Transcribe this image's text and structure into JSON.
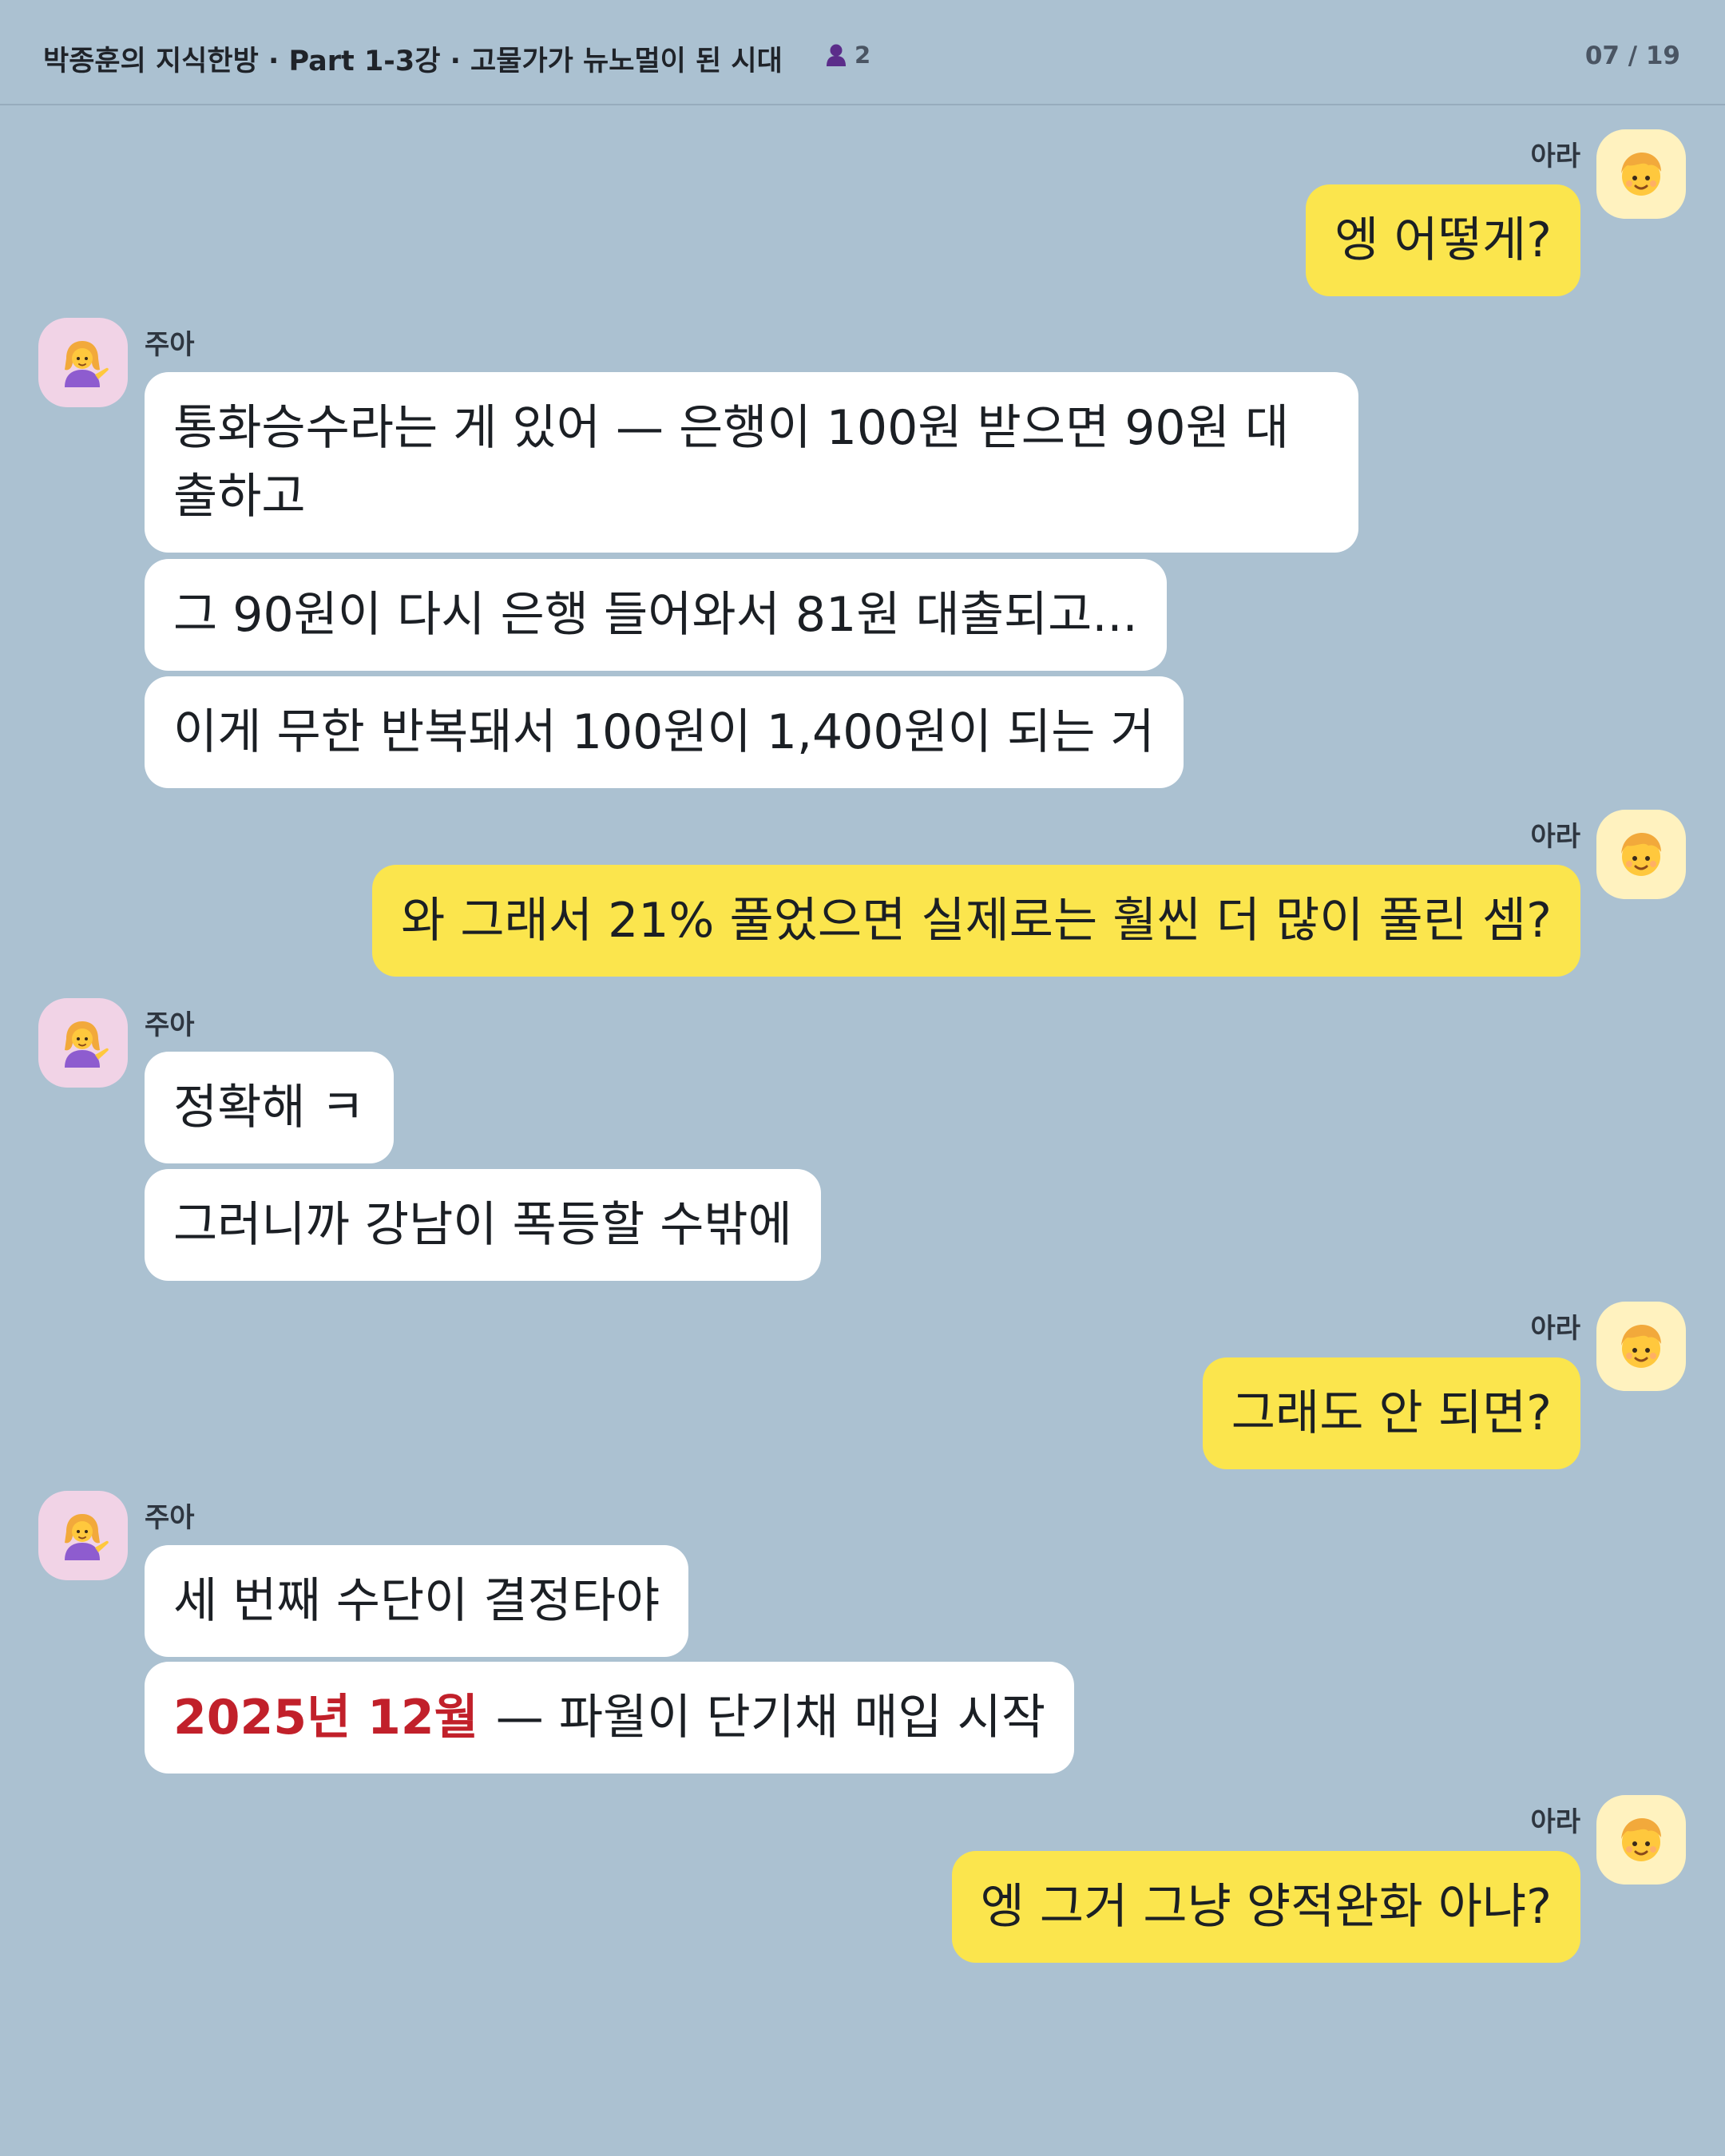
{
  "header": {
    "title": "박종훈의 지식한방 · Part 1-3강 · 고물가가 뉴노멀이 된 시대",
    "member_count": "2",
    "page_counter": "07 / 19"
  },
  "participants": {
    "me": {
      "name": "아라",
      "avatar_icon": "blond-child-emoji-icon"
    },
    "other": {
      "name": "주아",
      "avatar_icon": "person-tipping-hand-emoji-icon"
    }
  },
  "messages": [
    {
      "sender": "아라",
      "text": "엥 어떻게?"
    },
    {
      "sender": "주아",
      "text": "통화승수라는 게 있어 — 은행이 100원 받으면 90원 대출하고"
    },
    {
      "sender": "주아",
      "text": "그 90원이 다시 은행 들어와서 81원 대출되고..."
    },
    {
      "sender": "주아",
      "text": "이게 무한 반복돼서 100원이 1,400원이 되는 거"
    },
    {
      "sender": "아라",
      "text": "와 그래서 21% 풀었으면 실제로는 훨씬 더 많이 풀린 셈?"
    },
    {
      "sender": "주아",
      "text": "정확해 ㅋ"
    },
    {
      "sender": "주아",
      "text": "그러니까 강남이 폭등할 수밖에"
    },
    {
      "sender": "아라",
      "text": "그래도 안 되면?"
    },
    {
      "sender": "주아",
      "text": "세 번째 수단이 결정타야"
    },
    {
      "sender": "주아",
      "highlight": "2025년 12월",
      "text": "— 파월이 단기채 매입 시작"
    },
    {
      "sender": "아라",
      "text": "엥 그거 그냥 양적완화 아냐?"
    }
  ],
  "colors": {
    "background": "#abc1d1",
    "my_bubble": "#fbe54d",
    "other_bubble": "#ffffff",
    "highlight": "#c1202a"
  }
}
